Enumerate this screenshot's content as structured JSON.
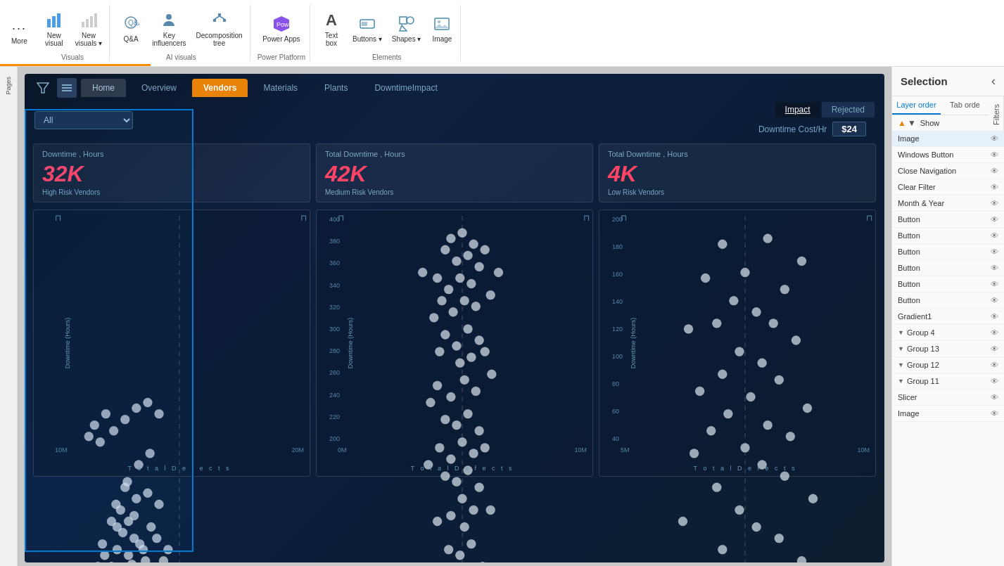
{
  "toolbar": {
    "more_label": "More",
    "groups": [
      {
        "name": "Pages",
        "label": "Pages",
        "items": []
      },
      {
        "name": "Visuals",
        "label": "Visuals",
        "items": [
          {
            "id": "new-visual",
            "icon": "📊",
            "label": "New\nvisual"
          },
          {
            "id": "new-visual-2",
            "icon": "📈",
            "label": "New\nvisuals ▾"
          }
        ]
      },
      {
        "name": "AI Visuals",
        "label": "AI visuals",
        "items": [
          {
            "id": "qa",
            "icon": "💬",
            "label": "Q&A"
          },
          {
            "id": "key-influencers",
            "icon": "👤",
            "label": "Key\ninfluencers"
          },
          {
            "id": "decomp-tree",
            "icon": "🌳",
            "label": "Decomposition\ntree"
          }
        ]
      },
      {
        "name": "Power Platform",
        "label": "Power Platform",
        "items": [
          {
            "id": "power-apps",
            "icon": "⚡",
            "label": "Power Apps"
          }
        ]
      },
      {
        "name": "Elements",
        "label": "Elements",
        "items": [
          {
            "id": "text-box",
            "icon": "T",
            "label": "Text\nbox"
          },
          {
            "id": "buttons",
            "icon": "🔲",
            "label": "Buttons ▾"
          },
          {
            "id": "shapes",
            "icon": "◻",
            "label": "Shapes ▾"
          },
          {
            "id": "image",
            "icon": "🖼",
            "label": "Image"
          }
        ]
      }
    ]
  },
  "dashboard": {
    "tabs": [
      {
        "id": "home",
        "label": "Home"
      },
      {
        "id": "overview",
        "label": "Overview"
      },
      {
        "id": "vendors",
        "label": "Vendors",
        "active": true
      },
      {
        "id": "materials",
        "label": "Materials"
      },
      {
        "id": "plants",
        "label": "Plants"
      },
      {
        "id": "downtime-impact",
        "label": "DowntimeImpact"
      }
    ],
    "filter_placeholder": "All",
    "impact_btn": "Impact",
    "rejected_btn": "Rejected",
    "cost_label": "Downtime Cost/Hr",
    "cost_value": "$24",
    "kpis": [
      {
        "title": "Downtime , Hours",
        "value": "32K",
        "subtitle": "High Risk Vendors"
      },
      {
        "title": "Total Downtime , Hours",
        "value": "42K",
        "subtitle": "Medium Risk Vendors"
      },
      {
        "title": "Total Downtime , Hours",
        "value": "4K",
        "subtitle": "Low Risk Vendors"
      }
    ],
    "charts": [
      {
        "id": "chart1",
        "y_axis_label": "Downtime (Hours)",
        "x_axis_label": "Total Defects",
        "y_ticks": [
          "",
          "",
          "",
          "",
          "",
          "",
          "",
          "",
          "",
          ""
        ],
        "x_ticks": [
          "10M",
          "20M"
        ],
        "bottom_label": "T o t a l   D e f e c t s"
      },
      {
        "id": "chart2",
        "y_axis_label": "Downtime (Hours)",
        "x_axis_label": "Total Defects",
        "y_ticks": [
          "200",
          "280",
          "300",
          "320",
          "340",
          "360",
          "380",
          "400"
        ],
        "x_ticks": [
          "0M",
          "10M"
        ],
        "bottom_label": "T o t a l   D e f e c t s"
      },
      {
        "id": "chart3",
        "y_axis_label": "Downtime (Hours)",
        "x_axis_label": "Total Defects",
        "y_ticks": [
          "40",
          "60",
          "80",
          "100",
          "120",
          "140",
          "160",
          "180",
          "200"
        ],
        "x_ticks": [
          "5M",
          "10M"
        ],
        "bottom_label": "T o t a l   D e f e c t s"
      }
    ]
  },
  "right_panel": {
    "title": "Selection",
    "tabs": [
      {
        "id": "layer-order",
        "label": "Layer order",
        "active": true
      },
      {
        "id": "tab-order",
        "label": "Tab orde"
      }
    ],
    "sort_up_label": "▲",
    "sort_down_label": "▼",
    "show_label": "Show",
    "layers": [
      {
        "id": "image-1",
        "name": "Image",
        "selected": true,
        "type": "item"
      },
      {
        "id": "windows-button",
        "name": "Windows Button",
        "selected": false,
        "type": "item"
      },
      {
        "id": "close-navigation",
        "name": "Close Navigation",
        "selected": false,
        "type": "item"
      },
      {
        "id": "clear-filter",
        "name": "Clear Filter",
        "selected": false,
        "type": "item"
      },
      {
        "id": "month-year",
        "name": "Month & Year",
        "selected": false,
        "type": "item"
      },
      {
        "id": "button-1",
        "name": "Button",
        "selected": false,
        "type": "item"
      },
      {
        "id": "button-2",
        "name": "Button",
        "selected": false,
        "type": "item"
      },
      {
        "id": "button-3",
        "name": "Button",
        "selected": false,
        "type": "item"
      },
      {
        "id": "button-4",
        "name": "Button",
        "selected": false,
        "type": "item"
      },
      {
        "id": "button-5",
        "name": "Button",
        "selected": false,
        "type": "item"
      },
      {
        "id": "button-6",
        "name": "Button",
        "selected": false,
        "type": "item"
      },
      {
        "id": "gradient1",
        "name": "Gradient1",
        "selected": false,
        "type": "item"
      },
      {
        "id": "group-4",
        "name": "Group 4",
        "selected": false,
        "type": "group",
        "expanded": true
      },
      {
        "id": "group-13",
        "name": "Group 13",
        "selected": false,
        "type": "group",
        "expanded": true
      },
      {
        "id": "group-12",
        "name": "Group 12",
        "selected": false,
        "type": "group",
        "expanded": true
      },
      {
        "id": "group-11",
        "name": "Group 11",
        "selected": false,
        "type": "group",
        "expanded": true
      },
      {
        "id": "slicer",
        "name": "Slicer",
        "selected": false,
        "type": "item"
      },
      {
        "id": "image-2",
        "name": "Image",
        "selected": false,
        "type": "item"
      }
    ]
  }
}
